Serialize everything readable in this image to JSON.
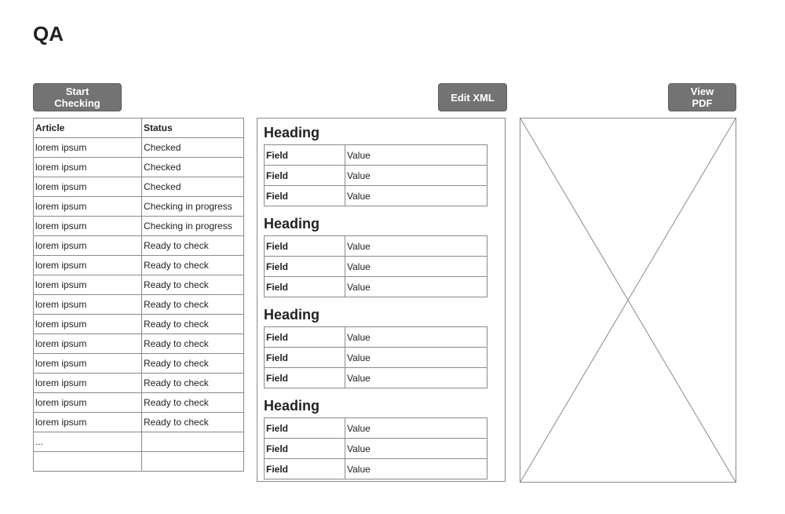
{
  "page": {
    "title": "QA"
  },
  "toolbar": {
    "start_checking_label": "Start Checking",
    "edit_xml_label": "Edit XML",
    "view_pdf_label": "View PDF"
  },
  "articles": {
    "headers": {
      "article": "Article",
      "status": "Status"
    },
    "rows": [
      {
        "article": "lorem ipsum",
        "status": "Checked"
      },
      {
        "article": "lorem ipsum",
        "status": "Checked"
      },
      {
        "article": "lorem ipsum",
        "status": "Checked"
      },
      {
        "article": "lorem ipsum",
        "status": "Checking in progress"
      },
      {
        "article": "lorem ipsum",
        "status": "Checking in progress"
      },
      {
        "article": "lorem ipsum",
        "status": "Ready to check"
      },
      {
        "article": "lorem ipsum",
        "status": "Ready to check"
      },
      {
        "article": "lorem ipsum",
        "status": "Ready to check"
      },
      {
        "article": "lorem ipsum",
        "status": "Ready to check"
      },
      {
        "article": "lorem ipsum",
        "status": "Ready to check"
      },
      {
        "article": "lorem ipsum",
        "status": "Ready to check"
      },
      {
        "article": "lorem ipsum",
        "status": "Ready to check"
      },
      {
        "article": "lorem ipsum",
        "status": "Ready to check"
      },
      {
        "article": "lorem ipsum",
        "status": "Ready to check"
      },
      {
        "article": "lorem ipsum",
        "status": "Ready to check"
      },
      {
        "article": "...",
        "status": ""
      },
      {
        "article": "",
        "status": ""
      }
    ]
  },
  "xml": {
    "sections": [
      {
        "heading": "Heading",
        "fields": [
          {
            "name": "Field",
            "value": "Value"
          },
          {
            "name": "Field",
            "value": "Value"
          },
          {
            "name": "Field",
            "value": "Value"
          }
        ]
      },
      {
        "heading": "Heading",
        "fields": [
          {
            "name": "Field",
            "value": "Value"
          },
          {
            "name": "Field",
            "value": "Value"
          },
          {
            "name": "Field",
            "value": "Value"
          }
        ]
      },
      {
        "heading": "Heading",
        "fields": [
          {
            "name": "Field",
            "value": "Value"
          },
          {
            "name": "Field",
            "value": "Value"
          },
          {
            "name": "Field",
            "value": "Value"
          }
        ]
      },
      {
        "heading": "Heading",
        "fields": [
          {
            "name": "Field",
            "value": "Value"
          },
          {
            "name": "Field",
            "value": "Value"
          },
          {
            "name": "Field",
            "value": "Value"
          }
        ]
      }
    ]
  },
  "pdf": {
    "placeholder_icon": "image-placeholder-icon"
  },
  "colors": {
    "button_bg": "#737373",
    "button_text": "#ffffff",
    "border": "#8a8a8a",
    "text": "#222222"
  }
}
